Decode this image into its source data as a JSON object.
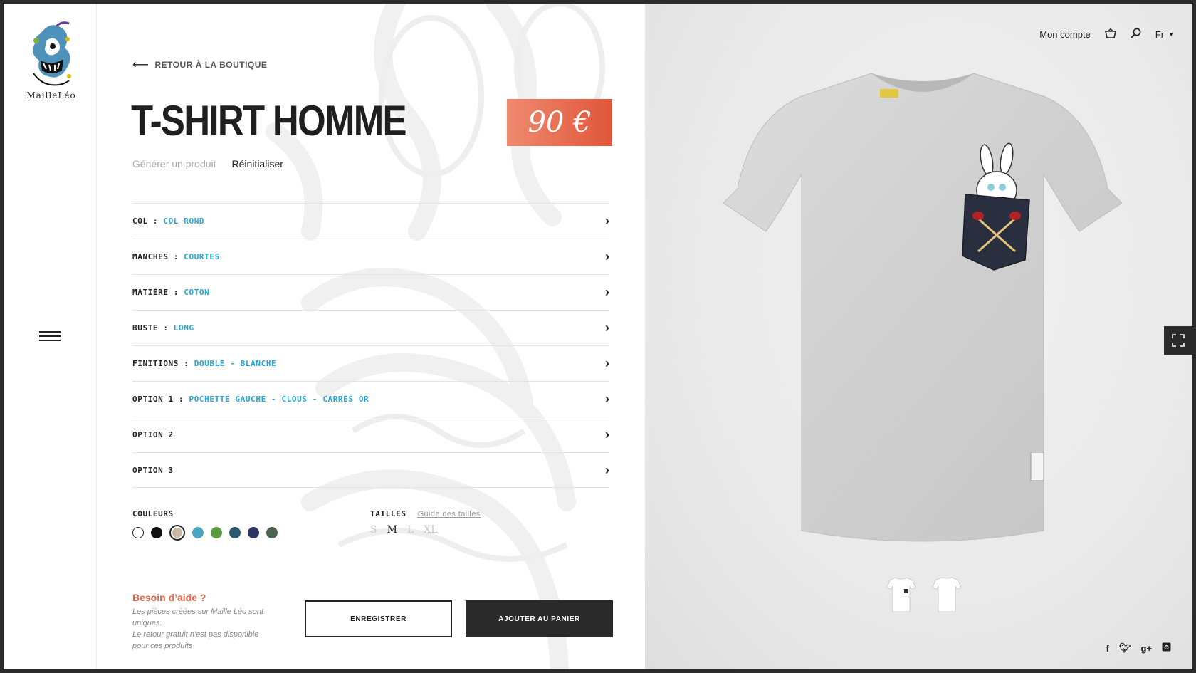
{
  "brand": {
    "name": "MailleLéo"
  },
  "nav": {
    "back_label": "Retour à la boutique",
    "account": "Mon compte",
    "language": "Fr"
  },
  "product": {
    "title": "T-shirt homme",
    "price": "90 €",
    "generate_label": "Générer un produit",
    "reset_label": "Réinitialiser"
  },
  "options": [
    {
      "label": "Col :",
      "value": "Col rond"
    },
    {
      "label": "Manches :",
      "value": "Courtes"
    },
    {
      "label": "Matière :",
      "value": "Coton"
    },
    {
      "label": "Buste :",
      "value": "Long"
    },
    {
      "label": "Finitions :",
      "value": "Double - Blanche"
    },
    {
      "label": "Option 1 :",
      "value": "Pochette gauche - Clous - Carrés or"
    },
    {
      "label": "Option 2",
      "value": ""
    },
    {
      "label": "Option 3",
      "value": ""
    }
  ],
  "colours": {
    "label": "Couleurs",
    "swatches": [
      "#ffffff",
      "#111111",
      "#c8b8a2",
      "#4aa5c0",
      "#5a9a3c",
      "#2d5a6e",
      "#2e3460",
      "#4d6650"
    ],
    "selected_index": 2
  },
  "sizes": {
    "label": "Tailles",
    "guide_label": "Guide des tailles",
    "options": [
      "S",
      "M",
      "L",
      "XL"
    ],
    "selected": "M"
  },
  "help": {
    "title": "Besoin d’aide ?",
    "text_1": "Les pièces créées sur Maille Léo sont uniques.",
    "text_2": "Le retour gratuit n’est pas disponible",
    "text_3": "pour ces produits"
  },
  "actions": {
    "save_label": "Enregistrer",
    "cart_label": "Ajouter au panier"
  },
  "icons": {
    "back": "arrow-left-icon",
    "cart": "basket-icon",
    "search": "search-icon",
    "menu": "hamburger-icon",
    "expand": "fullscreen-icon",
    "chevron": "chevron-right-icon",
    "social": [
      "facebook-icon",
      "twitter-icon",
      "google-plus-icon",
      "instagram-icon"
    ]
  },
  "colors": {
    "accent_price": "#e0563a",
    "accent_value": "#29a6d8",
    "help_title": "#e2674a"
  }
}
